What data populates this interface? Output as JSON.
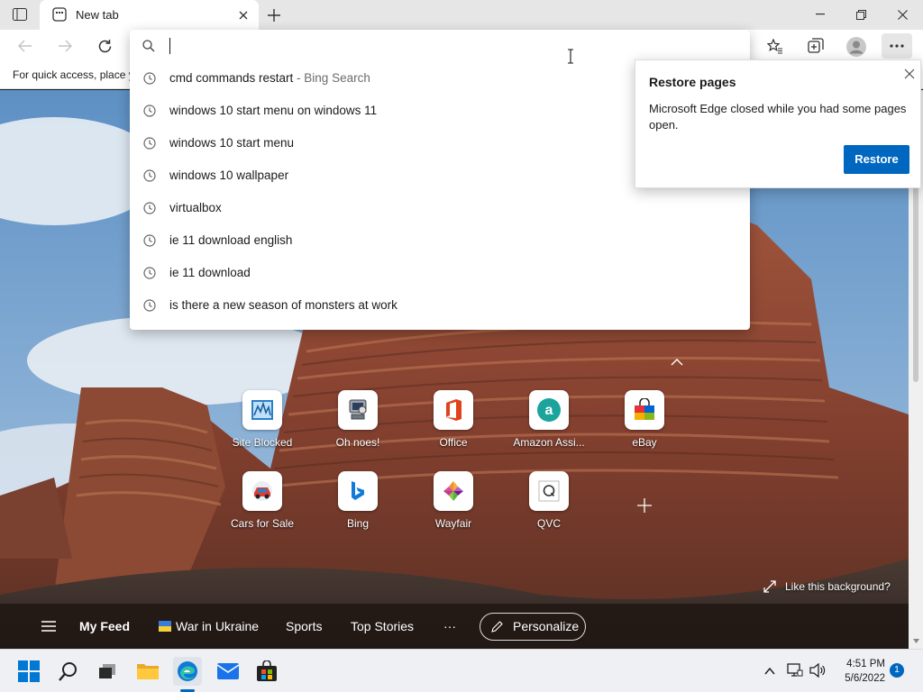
{
  "tab": {
    "title": "New tab"
  },
  "window": {
    "minimize": "—",
    "maximize": "⧉",
    "close": "✕"
  },
  "favbar": {
    "text": "For quick access, place y"
  },
  "omnibox": {
    "value": ""
  },
  "suggestions": [
    {
      "text": "cmd commands restart",
      "sub": " - Bing Search"
    },
    {
      "text": "windows 10 start menu on windows 11",
      "sub": ""
    },
    {
      "text": "windows 10 start menu",
      "sub": ""
    },
    {
      "text": "windows 10 wallpaper",
      "sub": ""
    },
    {
      "text": "virtualbox",
      "sub": ""
    },
    {
      "text": "ie 11 download english",
      "sub": ""
    },
    {
      "text": "ie 11 download",
      "sub": ""
    },
    {
      "text": "is there a new season of monsters at work",
      "sub": ""
    }
  ],
  "restore_popup": {
    "title": "Restore pages",
    "body": "Microsoft Edge closed while you had some pages open.",
    "button": "Restore"
  },
  "quick_links": [
    {
      "label": "Site Blocked",
      "icon": "site-blocked-icon"
    },
    {
      "label": "Oh noes!",
      "icon": "oh-noes-icon"
    },
    {
      "label": "Office",
      "icon": "office-icon"
    },
    {
      "label": "Amazon Assi...",
      "icon": "amazon-icon"
    },
    {
      "label": "eBay",
      "icon": "ebay-icon"
    },
    {
      "label": "Cars for Sale",
      "icon": "car-icon"
    },
    {
      "label": "Bing",
      "icon": "bing-icon"
    },
    {
      "label": "Wayfair",
      "icon": "wayfair-icon"
    },
    {
      "label": "QVC",
      "icon": "qvc-icon"
    }
  ],
  "background": {
    "like_text": "Like this background?"
  },
  "feed": {
    "my_feed": "My Feed",
    "war": "War in Ukraine",
    "sports": "Sports",
    "top_stories": "Top Stories",
    "more": "···",
    "personalize": "Personalize"
  },
  "taskbar": {
    "time": "4:51 PM",
    "date": "5/6/2022",
    "notifications": "1"
  },
  "colors": {
    "accent": "#0067c0",
    "edge_blue": "#0f7ad8"
  }
}
